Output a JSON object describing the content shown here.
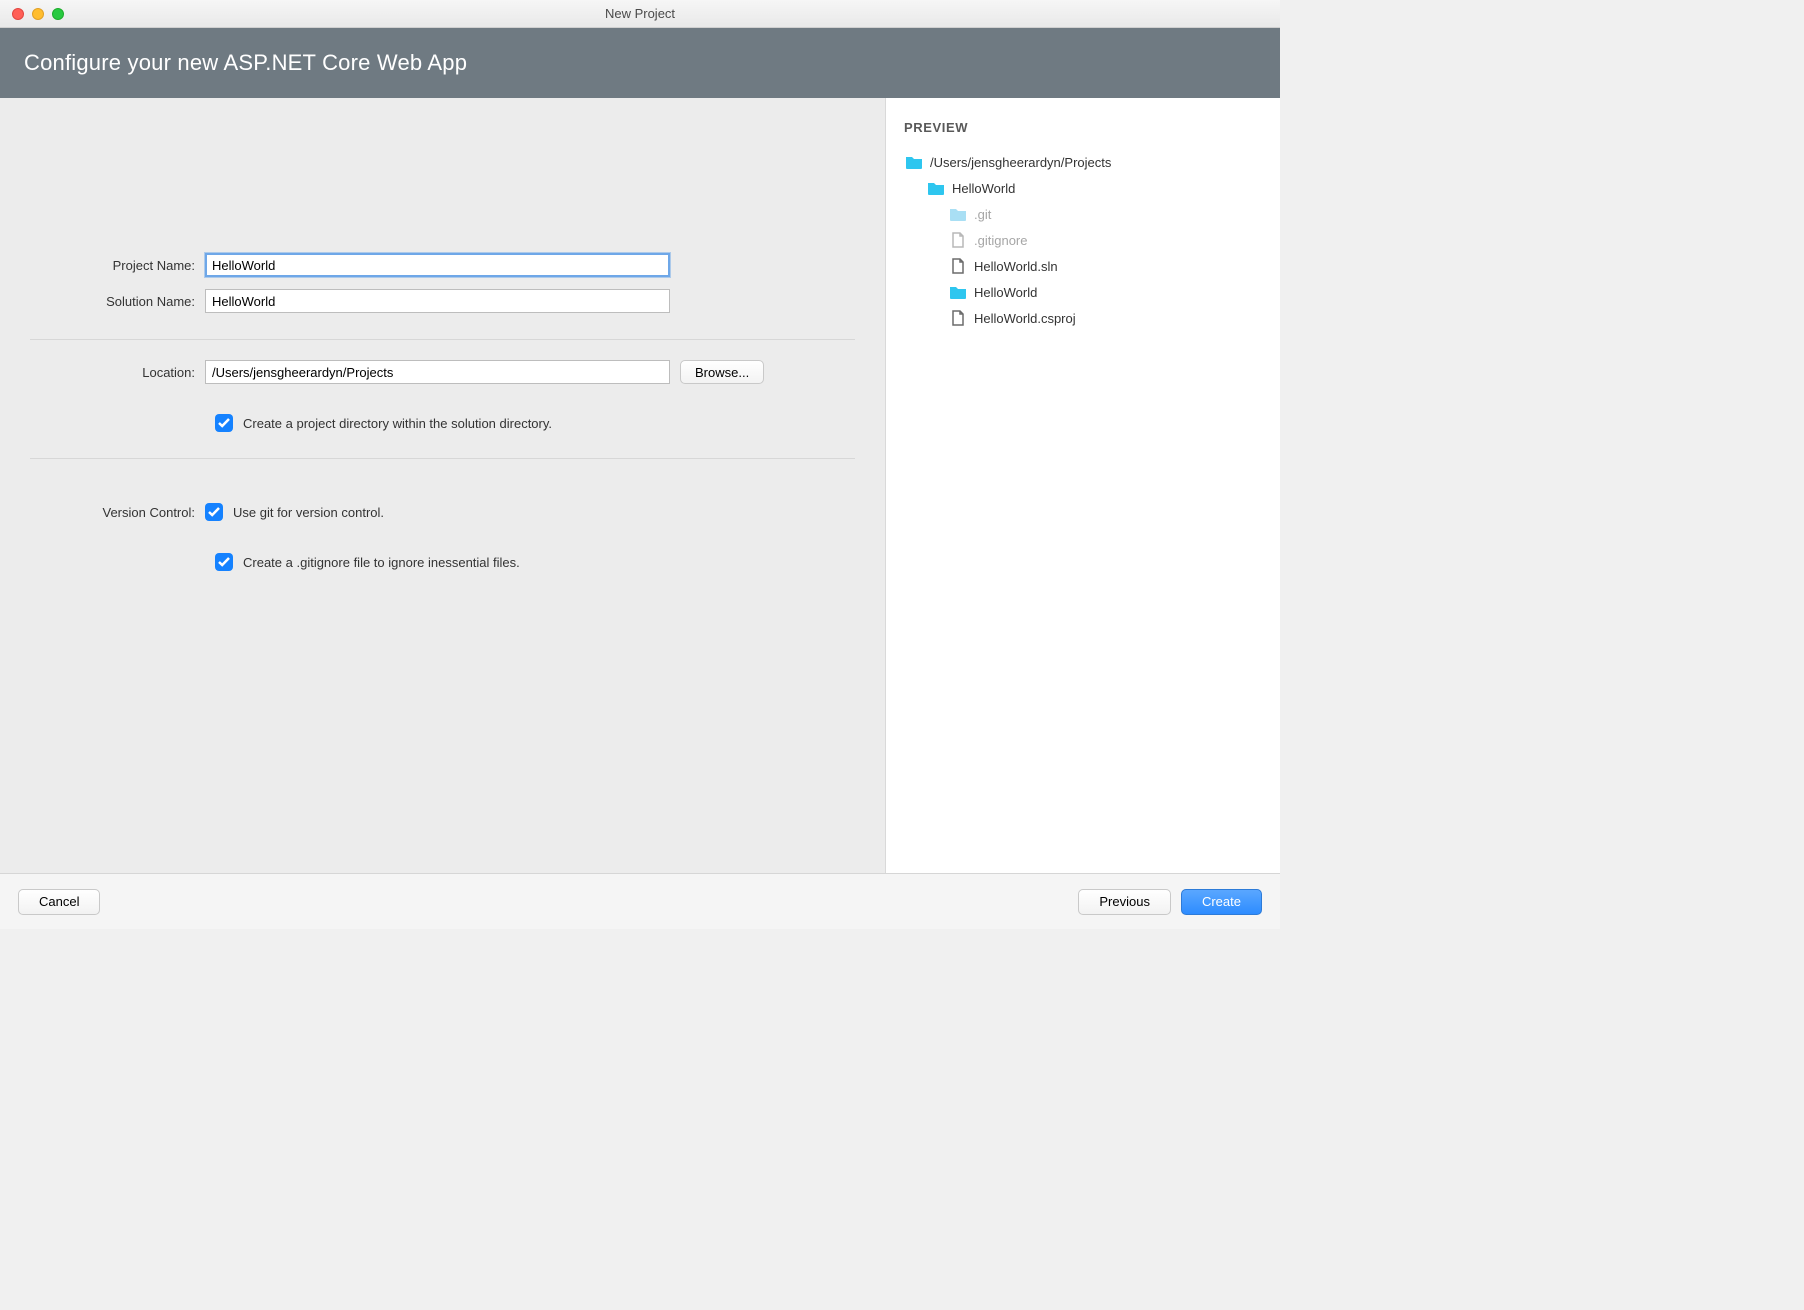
{
  "window": {
    "title": "New Project"
  },
  "header": {
    "title": "Configure your new ASP.NET Core Web App"
  },
  "form": {
    "project_name_label": "Project Name:",
    "project_name": "HelloWorld",
    "solution_name_label": "Solution Name:",
    "solution_name": "HelloWorld",
    "location_label": "Location:",
    "location": "/Users/jensgheerardyn/Projects",
    "browse_label": "Browse...",
    "create_subdir_label": "Create a project directory within the solution directory.",
    "version_control_label": "Version Control:",
    "use_git_label": "Use git for version control.",
    "create_gitignore_label": "Create a .gitignore file to ignore inessential files."
  },
  "preview": {
    "title": "PREVIEW",
    "items": [
      {
        "indent": 0,
        "type": "folder",
        "label": "/Users/jensgheerardyn/Projects",
        "dim": false
      },
      {
        "indent": 1,
        "type": "folder",
        "label": "HelloWorld",
        "dim": false
      },
      {
        "indent": 2,
        "type": "folder",
        "label": ".git",
        "dim": true
      },
      {
        "indent": 2,
        "type": "file",
        "label": ".gitignore",
        "dim": true
      },
      {
        "indent": 2,
        "type": "file",
        "label": "HelloWorld.sln",
        "dim": false
      },
      {
        "indent": 2,
        "type": "folder",
        "label": "HelloWorld",
        "dim": false
      },
      {
        "indent": 3,
        "type": "file",
        "label": "HelloWorld.csproj",
        "dim": false
      }
    ]
  },
  "footer": {
    "cancel": "Cancel",
    "previous": "Previous",
    "create": "Create"
  }
}
